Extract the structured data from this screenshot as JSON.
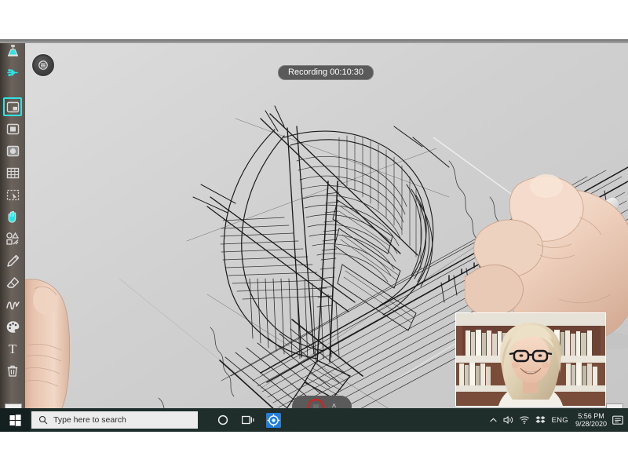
{
  "app": {
    "title": "Digital Sketch Tablet — Screen Recording",
    "canvas_label": "drawing-canvas"
  },
  "recording": {
    "badge_label": "Recording 00:10:30",
    "elapsed": "00:10:30",
    "status_word": "Recording",
    "stop_button_name": "stop-recording",
    "expand_chevron": "˄"
  },
  "menu": {
    "button_icon": "hamburger-menu-icon"
  },
  "toolbar": {
    "accent_color": "#2fe3e3",
    "background_color": "#6b625c",
    "items": [
      {
        "id": "projector",
        "icon": "projector-lamp-icon",
        "label": "Projector",
        "selected": false
      },
      {
        "id": "usb",
        "icon": "usb-icon",
        "label": "USB",
        "selected": false
      },
      {
        "id": "picture-in-picture",
        "icon": "picture-in-picture-icon",
        "label": "Picture in Picture",
        "selected": true
      },
      {
        "id": "fill-square",
        "icon": "filled-square-icon",
        "label": "Fill Square",
        "selected": false
      },
      {
        "id": "shade-circle",
        "icon": "shaded-circle-icon",
        "label": "Shade Circle",
        "selected": false
      },
      {
        "id": "grid",
        "icon": "grid-icon",
        "label": "Grid",
        "selected": false
      },
      {
        "id": "marquee-select",
        "icon": "marquee-select-icon",
        "label": "Select",
        "selected": false
      },
      {
        "id": "hand",
        "icon": "hand-icon",
        "label": "Pan",
        "selected": false
      },
      {
        "id": "shapes",
        "icon": "shapes-icon",
        "label": "Shapes",
        "selected": false
      },
      {
        "id": "pencil",
        "icon": "pencil-icon",
        "label": "Pencil",
        "selected": false
      },
      {
        "id": "eraser",
        "icon": "eraser-icon",
        "label": "Eraser",
        "selected": false
      },
      {
        "id": "ink",
        "icon": "ink-squiggle-icon",
        "label": "Ink",
        "selected": false
      },
      {
        "id": "palette",
        "icon": "color-palette-icon",
        "label": "Colors",
        "selected": false
      },
      {
        "id": "text",
        "icon": "text-tool-icon",
        "label": "T",
        "selected": false
      },
      {
        "id": "trash",
        "icon": "trash-icon",
        "label": "Delete",
        "selected": false
      }
    ],
    "left_arrow_label": "›",
    "right_arrow_label": "‹"
  },
  "webcam": {
    "name": "webcam-picture-in-picture",
    "description": "Smiling woman with glasses in front of bookshelves"
  },
  "taskbar": {
    "start_icon": "windows-start-icon",
    "search": {
      "placeholder": "Type here to search",
      "value": "",
      "icon": "search-icon"
    },
    "buttons": [
      {
        "id": "cortana",
        "icon": "cortana-circle-icon",
        "label": "Cortana"
      },
      {
        "id": "task-view",
        "icon": "task-view-icon",
        "label": "Task View"
      },
      {
        "id": "whiteboard-app",
        "icon": "whiteboard-app-icon",
        "label": "Whiteboard"
      }
    ],
    "tray": {
      "overflow_icon": "chevron-up-icon",
      "items": [
        {
          "id": "volume",
          "icon": "speaker-icon"
        },
        {
          "id": "network",
          "icon": "wifi-icon"
        },
        {
          "id": "dropbox",
          "icon": "dropbox-icon"
        }
      ],
      "language": "ENG",
      "time": "5:56 PM",
      "date": "9/28/2020",
      "action_center_icon": "action-center-icon"
    }
  },
  "artwork": {
    "name": "architectural-sketch",
    "description": "Pen-and-ink architectural sketch of a domed shell structure beside a bridge"
  }
}
